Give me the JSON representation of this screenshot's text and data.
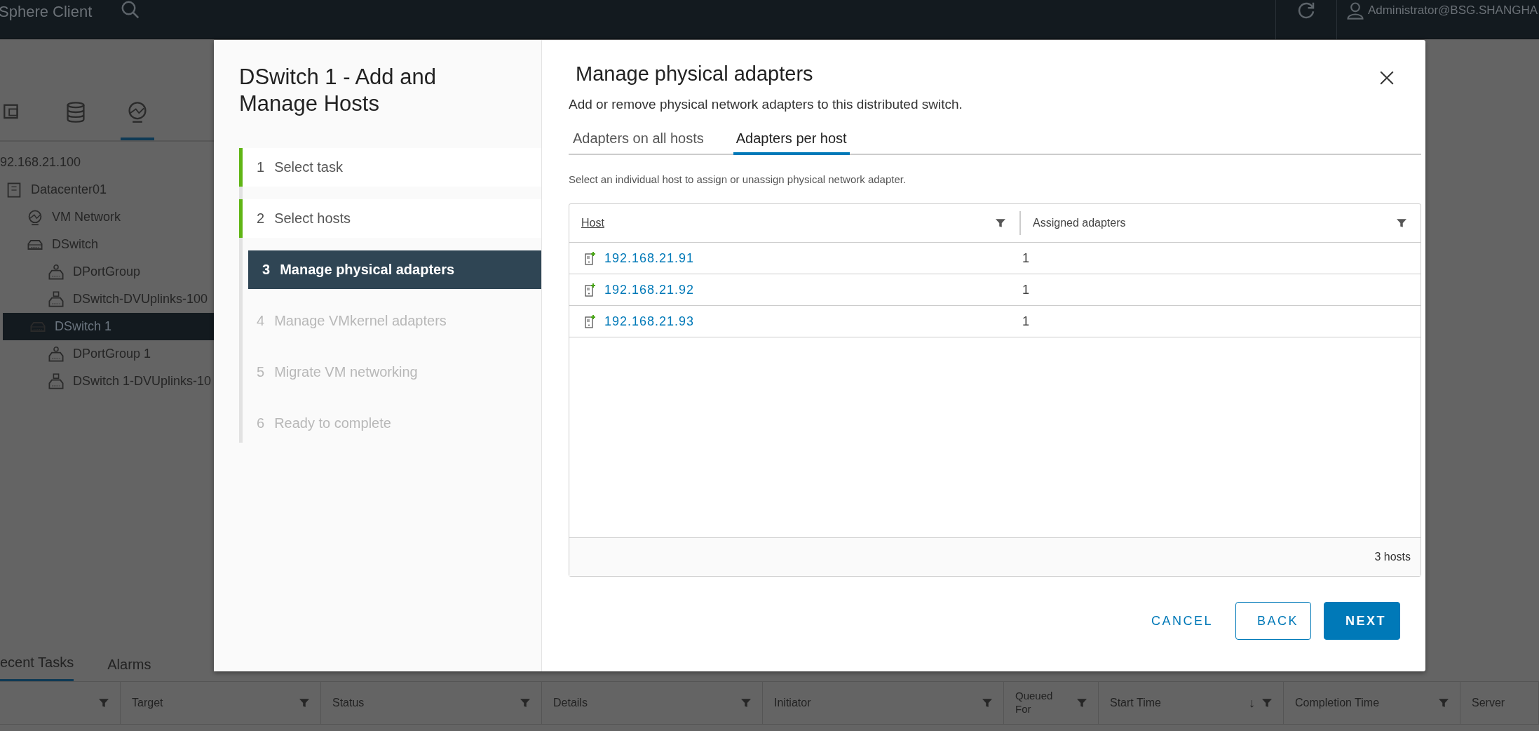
{
  "header": {
    "app_title": "Sphere Client",
    "user": "Administrator@BSG.SHANGHA"
  },
  "navigator": {
    "views": [
      {
        "kind": "vms",
        "selected": false
      },
      {
        "kind": "storage",
        "selected": false
      },
      {
        "kind": "network",
        "selected": true
      }
    ],
    "tree": [
      {
        "label": "92.168.21.100",
        "selected": false,
        "children": [
          {
            "label": "Datacenter01",
            "kind": "datacenter",
            "selected": false,
            "children": [
              {
                "label": "VM Network",
                "kind": "network",
                "selected": false
              },
              {
                "label": "DSwitch",
                "kind": "switch",
                "selected": false,
                "children": [
                  {
                    "label": "DPortGroup",
                    "kind": "portgroup",
                    "selected": false
                  },
                  {
                    "label": "DSwitch-DVUplinks-100",
                    "kind": "uplinks",
                    "selected": false
                  }
                ]
              },
              {
                "label": "DSwitch 1",
                "kind": "switch",
                "selected": true,
                "children": [
                  {
                    "label": "DPortGroup 1",
                    "kind": "portgroup",
                    "selected": false
                  },
                  {
                    "label": "DSwitch 1-DVUplinks-10",
                    "kind": "uplinks",
                    "selected": false
                  }
                ]
              }
            ]
          }
        ]
      }
    ]
  },
  "bottom_panel": {
    "tabs": [
      {
        "label": "ecent Tasks",
        "selected": true
      },
      {
        "label": "Alarms",
        "selected": false
      }
    ],
    "columns": [
      {
        "filter": true
      },
      {
        "label": "Target",
        "filter": true
      },
      {
        "label": "Status",
        "filter": true
      },
      {
        "label": "Details",
        "filter": true
      },
      {
        "label": "Initiator",
        "filter": true
      },
      {
        "label": "Queued For",
        "filter": true
      },
      {
        "label": "Start Time",
        "filter": true,
        "sort_indicator": "↓"
      },
      {
        "label": "Completion Time",
        "filter": true
      },
      {
        "label": "Server",
        "filter": false
      }
    ]
  },
  "dialog": {
    "title": "DSwitch 1 - Add and Manage Hosts",
    "steps": [
      {
        "number": "1",
        "label": "Select task",
        "completed": true,
        "selected": false,
        "disabled": false
      },
      {
        "number": "2",
        "label": "Select hosts",
        "completed": true,
        "selected": false,
        "disabled": false
      },
      {
        "number": "3",
        "label": "Manage physical adapters",
        "completed": false,
        "selected": true,
        "disabled": false
      },
      {
        "number": "4",
        "label": "Manage VMkernel adapters",
        "completed": false,
        "selected": false,
        "disabled": true
      },
      {
        "number": "5",
        "label": "Migrate VM networking",
        "completed": false,
        "selected": false,
        "disabled": true
      },
      {
        "number": "6",
        "label": "Ready to complete",
        "completed": false,
        "selected": false,
        "disabled": true
      }
    ],
    "page_title": "Manage physical adapters",
    "description": "Add or remove physical network adapters to this distributed switch.",
    "tabs": [
      {
        "label": "Adapters on all hosts",
        "selected": false
      },
      {
        "label": "Adapters per host",
        "selected": true
      }
    ],
    "instruction": "Select an individual host to assign or unassign physical network adapter.",
    "table": {
      "columns": [
        {
          "label": "Host",
          "sortable": true
        },
        {
          "label": "Assigned adapters",
          "sortable": false
        }
      ],
      "rows": [
        {
          "host": "192.168.21.91",
          "assigned_adapters": "1"
        },
        {
          "host": "192.168.21.92",
          "assigned_adapters": "1"
        },
        {
          "host": "192.168.21.93",
          "assigned_adapters": "1"
        }
      ],
      "footer": "3 hosts"
    },
    "buttons": [
      {
        "label": "CANCEL",
        "kind": "flat"
      },
      {
        "label": "BACK",
        "kind": "outline"
      },
      {
        "label": "NEXT",
        "kind": "primary"
      }
    ]
  }
}
